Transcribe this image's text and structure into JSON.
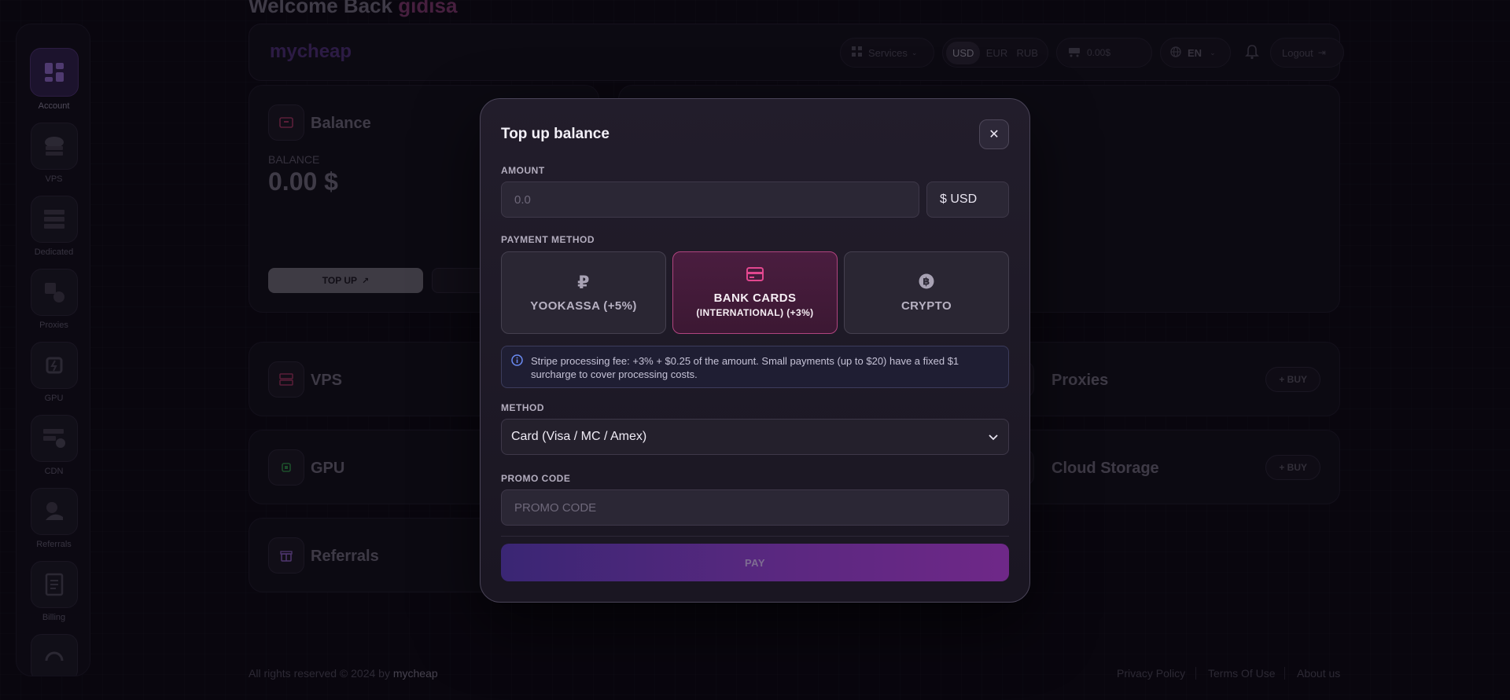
{
  "welcome": {
    "prefix": "Welcome Back",
    "username": "gidisa"
  },
  "sidebar": {
    "items": [
      {
        "label": "Account",
        "icon": "dashboard-icon",
        "active": true
      },
      {
        "label": "VPS",
        "icon": "vps-server-icon"
      },
      {
        "label": "Dedicated",
        "icon": "dedicated-server-icon"
      },
      {
        "label": "Proxies",
        "icon": "proxies-icon"
      },
      {
        "label": "GPU",
        "icon": "gpu-chip-icon"
      },
      {
        "label": "CDN",
        "icon": "cdn-icon"
      },
      {
        "label": "Referrals",
        "icon": "referrals-icon"
      },
      {
        "label": "Billing",
        "icon": "billing-icon"
      }
    ]
  },
  "topbar": {
    "logo": "mycheap",
    "services_label": "Services",
    "currencies": [
      "USD",
      "EUR",
      "RUB"
    ],
    "active_currency": "USD",
    "cart_amount": "0.00$",
    "language": "EN",
    "logout_label": "Logout"
  },
  "balance_card": {
    "title": "Balance",
    "balance_label": "BALANCE",
    "balance_value": "0.00 $",
    "topup_label": "TOP UP"
  },
  "services": [
    {
      "title": "VPS"
    },
    {
      "title": "GPU"
    },
    {
      "title": "Referrals"
    },
    {
      "title": "Proxies",
      "buy_label": "+ BUY"
    },
    {
      "title": "Cloud Storage",
      "buy_label": "+ BUY"
    }
  ],
  "footer": {
    "copyright": "All rights reserved © 2024 by",
    "brand": "mycheap",
    "links": [
      "Privacy Policy",
      "Terms Of Use",
      "About us"
    ]
  },
  "modal": {
    "title": "Top up balance",
    "close_icon": "close-icon",
    "amount_label": "AMOUNT",
    "amount_placeholder": "0.0",
    "currency_value": "$ USD",
    "payment_method_label": "PAYMENT METHOD",
    "payment_methods": [
      {
        "line1": "YOOKASSA (+5%)",
        "line2": "",
        "icon": "ruble-icon",
        "selected": false
      },
      {
        "line1": "BANK CARDS",
        "line2": "(INTERNATIONAL) (+3%)",
        "icon": "credit-card-icon",
        "selected": true
      },
      {
        "line1": "CRYPTO",
        "line2": "",
        "icon": "bitcoin-icon",
        "selected": false
      }
    ],
    "info_text": "Stripe processing fee: +3% + $0.25 of the amount. Small payments (up to $20) have a fixed $1 surcharge to cover processing costs.",
    "method_label": "METHOD",
    "method_value": "Card (Visa / MC / Amex)",
    "promo_label": "PROMO CODE",
    "promo_placeholder": "PROMO CODE",
    "pay_label": "PAY"
  },
  "colors": {
    "accent_pink": "#b0447f",
    "accent_purple": "#5a2880",
    "background": "#0b0812"
  }
}
